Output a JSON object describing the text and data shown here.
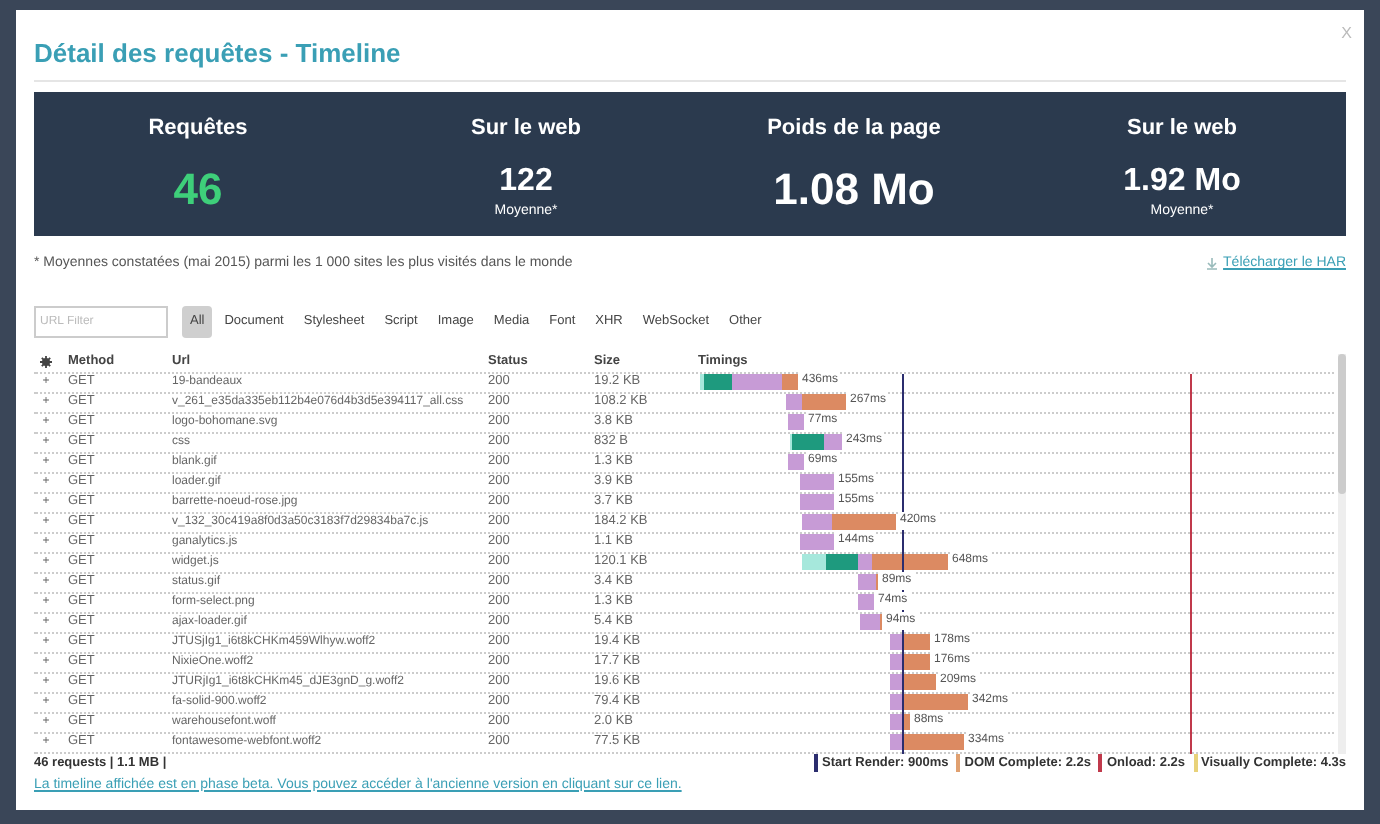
{
  "modal": {
    "title": "Détail des requêtes - Timeline",
    "close": "X"
  },
  "stats": [
    {
      "label": "Requêtes",
      "value": "46",
      "kind": "highlight"
    },
    {
      "label": "Sur le web",
      "value": "122",
      "note": "Moyenne*",
      "kind": "average"
    },
    {
      "label": "Poids de la page",
      "value": "1.08 Mo",
      "kind": "main"
    },
    {
      "label": "Sur le web",
      "value": "1.92 Mo",
      "note": "Moyenne*",
      "kind": "average"
    }
  ],
  "footnote": "* Moyennes constatées (mai 2015) parmi les 1 000 sites les plus visités dans le monde",
  "download_link": "Télécharger le HAR",
  "filter": {
    "placeholder": "URL Filter"
  },
  "filter_tabs": [
    {
      "label": "All",
      "selected": true
    },
    {
      "label": "Document",
      "selected": false
    },
    {
      "label": "Stylesheet",
      "selected": false
    },
    {
      "label": "Script",
      "selected": false
    },
    {
      "label": "Image",
      "selected": false
    },
    {
      "label": "Media",
      "selected": false
    },
    {
      "label": "Font",
      "selected": false
    },
    {
      "label": "XHR",
      "selected": false
    },
    {
      "label": "WebSocket",
      "selected": false
    },
    {
      "label": "Other",
      "selected": false
    }
  ],
  "table": {
    "columns": [
      "Method",
      "Url",
      "Status",
      "Size",
      "Timings"
    ],
    "rows": [
      {
        "expander": "+",
        "method": "GET",
        "url": "19-bandeaux",
        "status": "200",
        "size": "19.2 KB",
        "timing": "436ms"
      },
      {
        "expander": "+",
        "method": "GET",
        "url": "v_261_e35da335eb112b4e076d4b3d5e394117_all.css",
        "status": "200",
        "size": "108.2 KB",
        "timing": "267ms"
      },
      {
        "expander": "+",
        "method": "GET",
        "url": "logo-bohomane.svg",
        "status": "200",
        "size": "3.8 KB",
        "timing": "77ms"
      },
      {
        "expander": "+",
        "method": "GET",
        "url": "css",
        "status": "200",
        "size": "832 B",
        "timing": "243ms"
      },
      {
        "expander": "+",
        "method": "GET",
        "url": "blank.gif",
        "status": "200",
        "size": "1.3 KB",
        "timing": "69ms"
      },
      {
        "expander": "+",
        "method": "GET",
        "url": "loader.gif",
        "status": "200",
        "size": "3.9 KB",
        "timing": "155ms"
      },
      {
        "expander": "+",
        "method": "GET",
        "url": "barrette-noeud-rose.jpg",
        "status": "200",
        "size": "3.7 KB",
        "timing": "155ms"
      },
      {
        "expander": "+",
        "method": "GET",
        "url": "v_132_30c419a8f0d3a50c3183f7d29834ba7c.js",
        "status": "200",
        "size": "184.2 KB",
        "timing": "420ms"
      },
      {
        "expander": "+",
        "method": "GET",
        "url": "ganalytics.js",
        "status": "200",
        "size": "1.1 KB",
        "timing": "144ms"
      },
      {
        "expander": "+",
        "method": "GET",
        "url": "widget.js",
        "status": "200",
        "size": "120.1 KB",
        "timing": "648ms"
      },
      {
        "expander": "+",
        "method": "GET",
        "url": "status.gif",
        "status": "200",
        "size": "3.4 KB",
        "timing": "89ms"
      },
      {
        "expander": "+",
        "method": "GET",
        "url": "form-select.png",
        "status": "200",
        "size": "1.3 KB",
        "timing": "74ms"
      },
      {
        "expander": "+",
        "method": "GET",
        "url": "ajax-loader.gif",
        "status": "200",
        "size": "5.4 KB",
        "timing": "94ms"
      },
      {
        "expander": "+",
        "method": "GET",
        "url": "JTUSjIg1_i6t8kCHKm459Wlhyw.woff2",
        "status": "200",
        "size": "19.4 KB",
        "timing": "178ms"
      },
      {
        "expander": "+",
        "method": "GET",
        "url": "NixieOne.woff2",
        "status": "200",
        "size": "17.7 KB",
        "timing": "176ms"
      },
      {
        "expander": "+",
        "method": "GET",
        "url": "JTURjIg1_i6t8kCHKm45_dJE3gnD_g.woff2",
        "status": "200",
        "size": "19.6 KB",
        "timing": "209ms"
      },
      {
        "expander": "+",
        "method": "GET",
        "url": "fa-solid-900.woff2",
        "status": "200",
        "size": "79.4 KB",
        "timing": "342ms"
      },
      {
        "expander": "+",
        "method": "GET",
        "url": "warehousefont.woff",
        "status": "200",
        "size": "2.0 KB",
        "timing": "88ms"
      },
      {
        "expander": "+",
        "method": "GET",
        "url": "fontawesome-webfont.woff2",
        "status": "200",
        "size": "77.5 KB",
        "timing": "334ms"
      }
    ]
  },
  "summary": "46 requests | 1.1 MB |",
  "legend": [
    {
      "label": "Start Render: 900ms",
      "color": "#2b2d6e"
    },
    {
      "label": "DOM Complete: 2.2s",
      "color": "#e0a070"
    },
    {
      "label": "Onload: 2.2s",
      "color": "#c0394b"
    },
    {
      "label": "Visually Complete: 4.3s",
      "color": "#e8d27a"
    }
  ],
  "beta_notice": "La timeline affichée est en phase beta. Vous pouvez accéder à l'ancienne version en cliquant sur ce lien."
}
